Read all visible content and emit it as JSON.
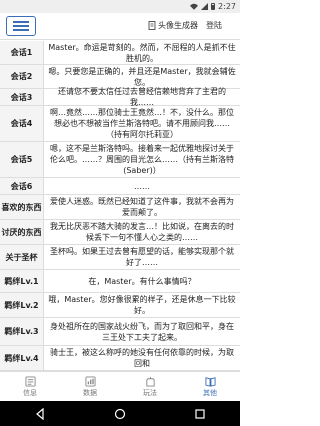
{
  "status": {
    "time": "2:27"
  },
  "header": {
    "avatar_label": "头像生成器",
    "login_label": "登陆"
  },
  "rows": [
    {
      "label": "会话1",
      "text": "Master。命运是苛刻的。然而，不屈程的人是抓不住胜机的。"
    },
    {
      "label": "会话2",
      "text": "嗯。只要您是正确的，并且还是Master，我就会辅佐您。"
    },
    {
      "label": "会话3",
      "text": "还请您不要太信任过去曾经信赖地背弃了主君的我……"
    },
    {
      "label": "会话4",
      "text": "啊…竟然……那位骑士王竟然…！不，没什么。那位想必也不想被当作兰斯洛特吧。请不用顾问我……（持有阿尔托莉亚）"
    },
    {
      "label": "会话5",
      "text": "嗯，这不是兰斯洛特吗。接着来一起优雅地探讨关于伦么吧。……？周围的目光怎么……（持有兰斯洛特(Saber)）"
    },
    {
      "label": "会话6",
      "text": "……"
    },
    {
      "label": "喜欢的东西",
      "text": "爱使人迷惑。既然已经知道了这件事，我就不会再为爱而颠了。"
    },
    {
      "label": "讨厌的东西",
      "text": "我无比厌恶不踏大骑的发言…！比如说，在离去的时候丢下一句不懂人心之类的……"
    },
    {
      "label": "关于圣杯",
      "text": "圣杯吗。如果王过去曾有愿望的话，能够实现那个就好了……"
    },
    {
      "label": "羁绊Lv.1",
      "text": "在，Master。有什么事情吗？"
    },
    {
      "label": "羁绊Lv.2",
      "text": "哦，Master。您好像很累的样子，还是休息一下比较好。"
    },
    {
      "label": "羁绊Lv.3",
      "text": "身处祖所在的国家战火纷飞，而为了取回和平，身在三王处下工夫了起来。"
    },
    {
      "label": "羁绊Lv.4",
      "text": "骑士王，被这么称呼的她没有任何依靠的时候，为取回和"
    }
  ],
  "nav": [
    {
      "label": "信息",
      "icon": "info-icon"
    },
    {
      "label": "数据",
      "icon": "data-icon"
    },
    {
      "label": "玩法",
      "icon": "play-icon"
    },
    {
      "label": "其他",
      "icon": "other-icon",
      "active": true
    }
  ],
  "colors": {
    "accent": "#3b6fb5"
  }
}
